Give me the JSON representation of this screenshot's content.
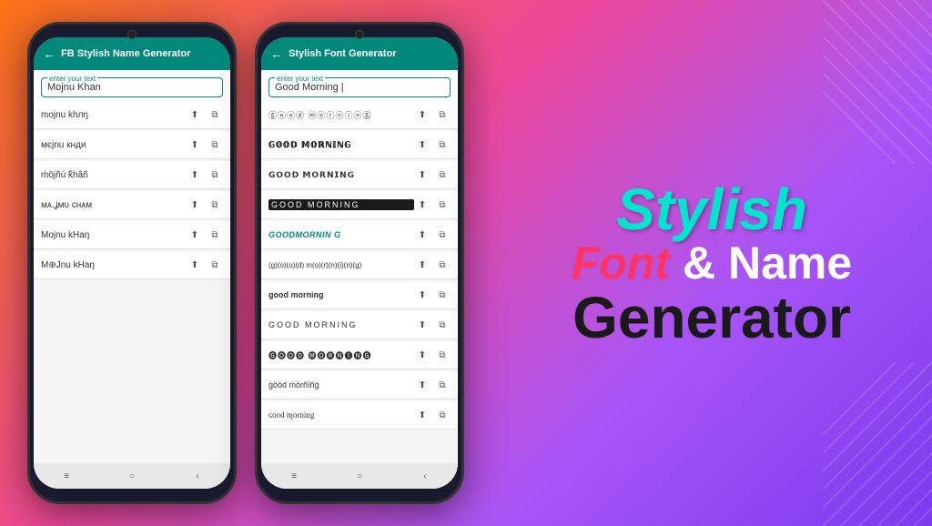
{
  "background": {
    "gradient": "linear-gradient(135deg, #f97316 0%, #ec4899 40%, #a855f7 70%, #7c3aed 100%)"
  },
  "phone1": {
    "appbar": {
      "title": "FB Stylish Name Generator",
      "back": "←"
    },
    "input": {
      "label": "enter your text",
      "value": "Mojnu Khan",
      "placeholder": "enter your text"
    },
    "fontItems": [
      {
        "text": "mojnu khлŋ",
        "style": "normal"
      },
      {
        "text": "мєjnu кнди",
        "style": "normal"
      },
      {
        "text": "ṁöjñú k̂hâñ",
        "style": "normal"
      },
      {
        "text": "ᴍᴀ.ʝᴍᴜ ᴄʜᴀᴍ",
        "style": "normal"
      },
      {
        "text": "Mojnu kHaŋ",
        "style": "normal"
      },
      {
        "text": "M⊕Jnu kHaŋ",
        "style": "normal"
      }
    ],
    "bottomNav": [
      "≡",
      "○",
      "‹"
    ]
  },
  "phone2": {
    "appbar": {
      "title": "Stylish Font Generator",
      "back": "←"
    },
    "input": {
      "label": "enter your text",
      "value": "Good Morning |",
      "placeholder": "enter your text"
    },
    "fontItems": [
      {
        "text": "ⓖⓞⓞⓓ ⓜⓞⓡⓝⓘⓝⓖ",
        "style": "circular"
      },
      {
        "text": "𝔾𝕆𝕆𝔻 𝕄𝕆ℝℕ𝕀ℕ𝔾",
        "style": "outlined"
      },
      {
        "text": "𝗚𝗢𝗢𝗗 𝗠𝗢𝗥𝗡𝗜𝗡𝗚",
        "style": "bold-serif"
      },
      {
        "text": "GOOD MORNING",
        "style": "impact"
      },
      {
        "text": "GOODMORNIN G",
        "style": "teal"
      },
      {
        "text": "(g)(o)(o)(d) m(o)(r)(n)(i)(n)(g)",
        "style": "parenthesis"
      },
      {
        "text": "good morning",
        "style": "bold-small"
      },
      {
        "text": "GOOD MORNING",
        "style": "caps"
      },
      {
        "text": "🅖🅞🅞🅓 🅜🅞🅡🅝🅘🅝🅖",
        "style": "square"
      },
      {
        "text": "ġööḋ ṁörñïñġ",
        "style": "fancy"
      },
      {
        "text": "ɢood ɱorning",
        "style": "cursive"
      }
    ],
    "bottomNav": [
      "≡",
      "○",
      "‹"
    ]
  },
  "promo": {
    "line1": "Stylish",
    "line2_part1": "Font",
    "line2_part2": "& Name",
    "line3": "Generator"
  },
  "actions": {
    "share_icon": "⬆",
    "copy_icon": "⧉"
  }
}
